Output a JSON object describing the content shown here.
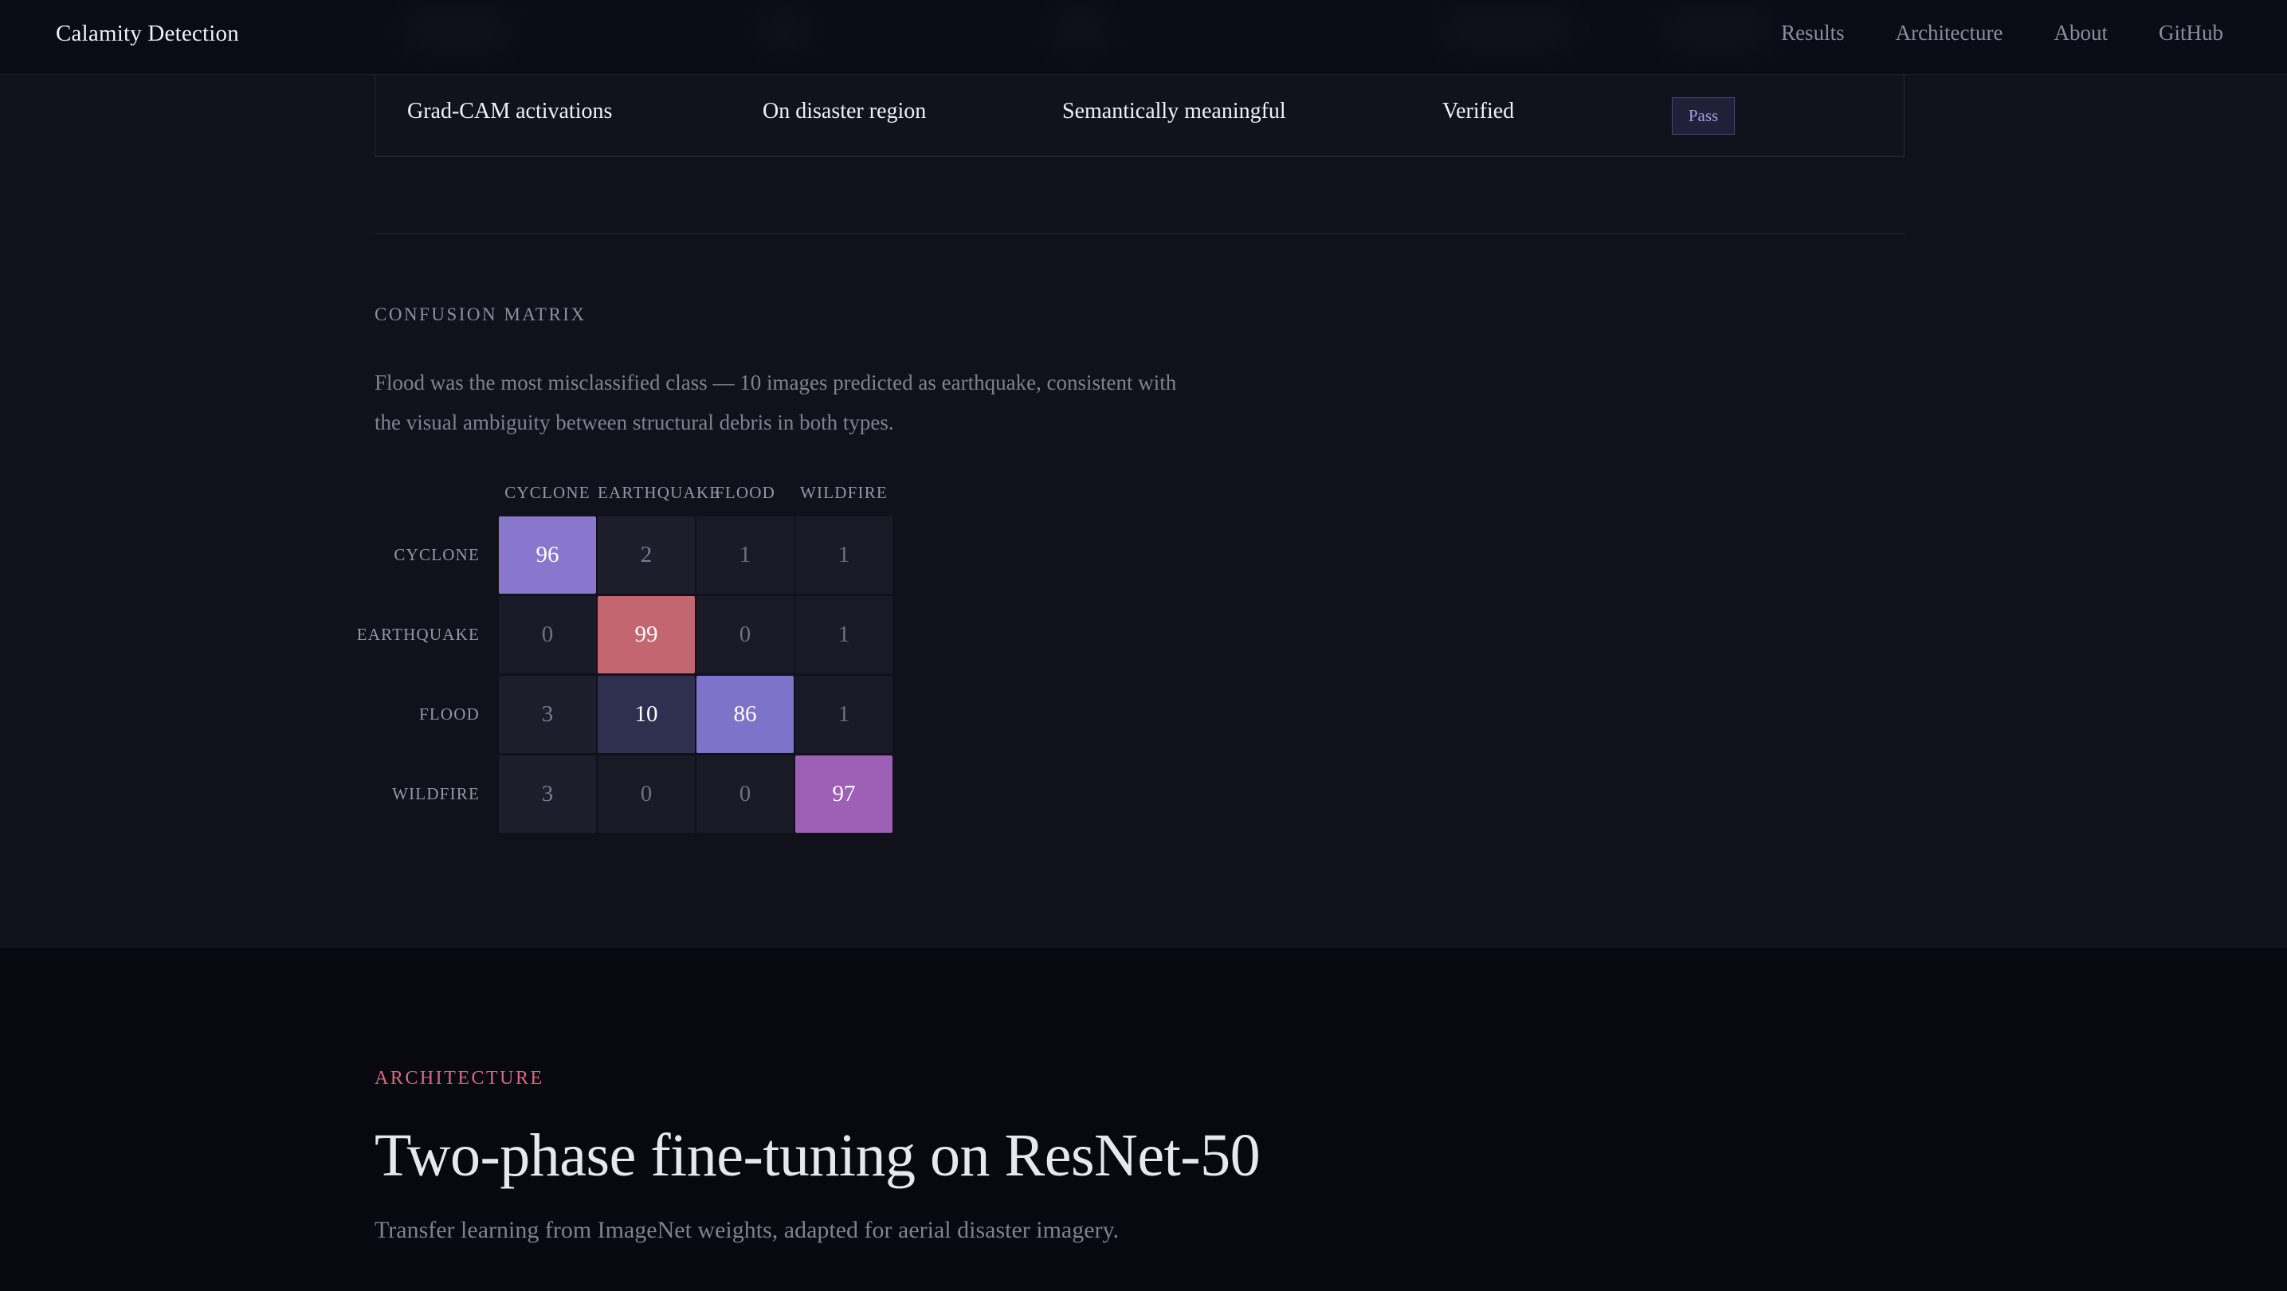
{
  "nav": {
    "brand": "Calamity Detection",
    "links": [
      "Results",
      "Architecture",
      "About",
      "GitHub"
    ]
  },
  "verification_row": {
    "check": "Grad-CAM activations",
    "expected": "On disaster region",
    "observed": "Semantically meaningful",
    "status": "Verified",
    "badge": "Pass"
  },
  "confusion_matrix": {
    "label": "CONFUSION MATRIX",
    "description": "Flood was the most misclassified class — 10 images predicted as earthquake, consistent with the visual ambiguity between structural debris in both types."
  },
  "chart_data": {
    "type": "heatmap",
    "columns": [
      "CYCLONE",
      "EARTHQUAKE",
      "FLOOD",
      "WILDFIRE"
    ],
    "rows": [
      "CYCLONE",
      "EARTHQUAKE",
      "FLOOD",
      "WILDFIRE"
    ],
    "values": [
      [
        96,
        2,
        1,
        1
      ],
      [
        0,
        99,
        0,
        1
      ],
      [
        3,
        10,
        86,
        1
      ],
      [
        3,
        0,
        0,
        97
      ]
    ],
    "diagonal_colors": [
      "#8877cc",
      "#c46670",
      "#7d73c8",
      "#9e5fb6"
    ],
    "offdiag_color": "#1a1a27",
    "highlight_color": "#2f3050"
  },
  "architecture": {
    "label": "ARCHITECTURE",
    "title": "Two-phase fine-tuning on ResNet-50",
    "subtitle": "Transfer learning from ImageNet weights, adapted for aerial disaster imagery."
  }
}
